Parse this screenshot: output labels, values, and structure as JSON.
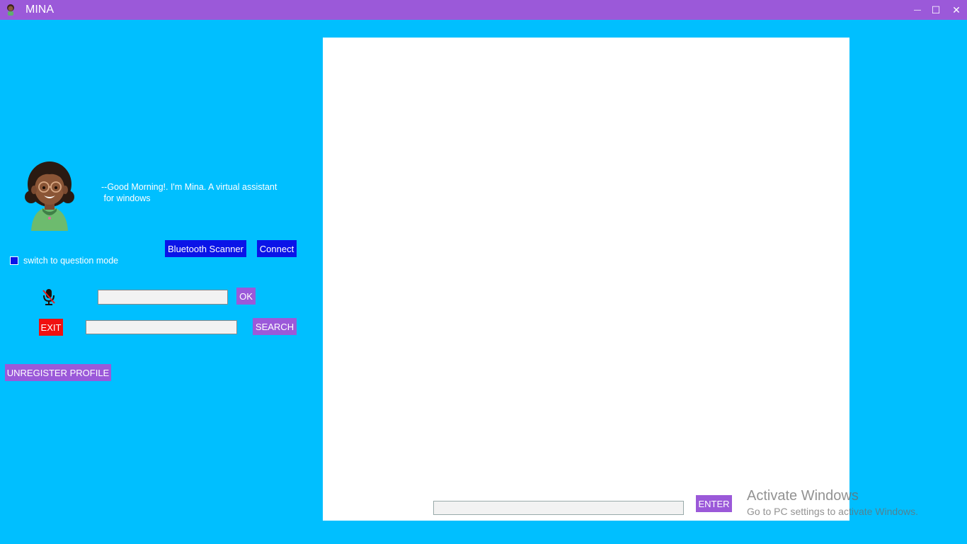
{
  "window": {
    "title": "MINA",
    "controls": {
      "minimize": "—",
      "maximize": "☐",
      "close": "✕"
    }
  },
  "assistant": {
    "greeting": "--Good Morning!. I'm Mina. A virtual assistant\n for windows"
  },
  "buttons": {
    "bluetooth_scanner": "Bluetooth Scanner",
    "connect": "Connect",
    "ok": "OK",
    "exit": "EXIT",
    "search": "SEARCH",
    "unregister_profile": "UNREGISTER PROFILE",
    "enter": "ENTER"
  },
  "question_mode": {
    "label": "switch to question mode",
    "checked": true
  },
  "inputs": {
    "command_value": "",
    "search_value": "",
    "chat_value": ""
  },
  "watermark": {
    "title": "Activate Windows",
    "subtitle": "Go to PC settings to activate Windows."
  },
  "colors": {
    "background": "#00bfff",
    "titlebar": "#9b59d9",
    "blue_button": "#0a14e8",
    "purple_button": "#9b59d9",
    "exit_button": "#f01010"
  },
  "icons": {
    "app": "avatar-icon",
    "mic": "mic-muted-icon"
  }
}
